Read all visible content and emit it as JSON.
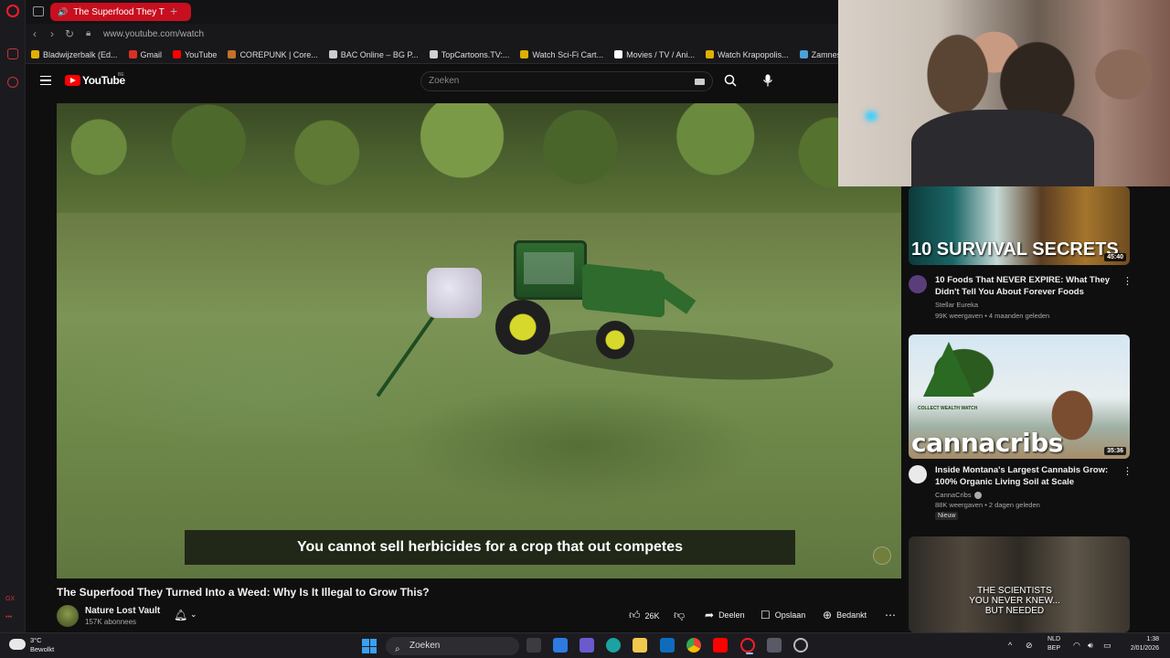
{
  "browser": {
    "active_tab_title": "The Superfood They T",
    "url": "www.youtube.com/watch",
    "bookmarks": [
      {
        "label": "Bladwijzerbalk (Ed...",
        "color": "#e0b000"
      },
      {
        "label": "Gmail",
        "color": "#d93025"
      },
      {
        "label": "YouTube",
        "color": "#ff0000"
      },
      {
        "label": "COREPUNK | Core...",
        "color": "#c2722a"
      },
      {
        "label": "BAC Online – BG P...",
        "color": "#cccccc"
      },
      {
        "label": "TopCartoons.TV:...",
        "color": "#d0d0d0"
      },
      {
        "label": "Watch Sci-Fi Cart...",
        "color": "#e0b000"
      },
      {
        "label": "Movies / TV / Ani...",
        "color": "#ffffff"
      },
      {
        "label": "Watch Krapopolis...",
        "color": "#e0b000"
      },
      {
        "label": "Zamnesia |",
        "color": "#4aa0d8"
      }
    ],
    "sidebar_label": "GX"
  },
  "youtube": {
    "wordmark": "YouTube",
    "country": "BE",
    "search_placeholder": "Zoeken"
  },
  "video": {
    "subtitle": "You cannot sell herbicides for a crop that out competes",
    "title": "The Superfood They Turned Into a Weed: Why Is It Illegal to Grow This?",
    "channel": "Nature Lost Vault",
    "subscribers": "157K abonnees",
    "likes": "26K",
    "share_label": "Deelen",
    "save_label": "Opslaan",
    "thanks_label": "Bedankt"
  },
  "recommendations": [
    {
      "thumb_text": "10 SURVIVAL SECRETS",
      "duration": "45:40",
      "title": "10 Foods That NEVER EXPIRE: What They Didn't Tell You About Forever Foods",
      "channel": "Stellar Eureka",
      "meta": "99K weergaven • 4 maanden geleden"
    },
    {
      "thumb_text": "cannacribs",
      "thumb_sub": "COLLECT WEALTH WATCH",
      "duration": "35:36",
      "title": "Inside Montana's Largest Cannabis Grow: 100% Organic Living Soil at Scale",
      "channel": "CannaCribs",
      "meta": "88K weergaven • 2 dagen geleden",
      "badge": "Nieuw"
    },
    {
      "thumb_text": "THE SCIENTISTS YOU NEVER KNEW... BUT NEEDED"
    }
  ],
  "taskbar": {
    "weather_temp": "3°C",
    "weather_desc": "Bewolkt",
    "search_label": "Zoeken",
    "lang_top": "NLD",
    "lang_bottom": "BEP",
    "time": "1:38",
    "date": "2/01/2026"
  }
}
